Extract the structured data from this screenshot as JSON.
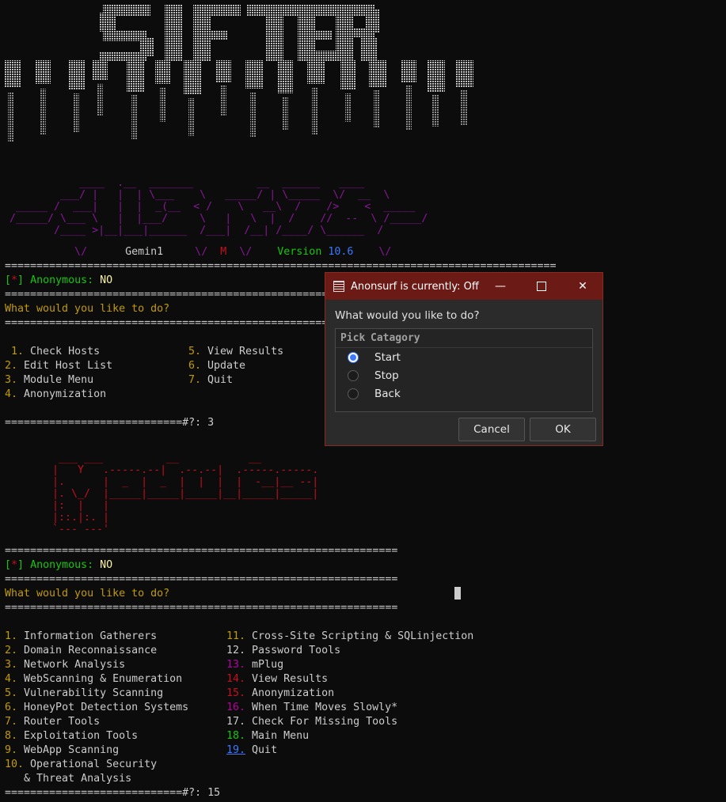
{
  "logo": {
    "text": "SIFTER",
    "subtitle_name": "Gemin1",
    "subtitle_m": "M",
    "version_label": "Version",
    "version_number": "10.6"
  },
  "separator_long": "=======================================================================================",
  "separator_med": "==============================================================",
  "status": {
    "bracket_open": "[",
    "star": "*",
    "bracket_close": "]",
    "label": "Anonymous:",
    "value": "NO"
  },
  "prompt_text": "What would you like to do?",
  "main_menu": {
    "left": [
      "1. Check Hosts",
      "2. Edit Host List",
      "3. Module Menu",
      "4. Anonymization"
    ],
    "right": [
      "5. View Results",
      "6. Update",
      "7. Quit"
    ],
    "input_prompt": "============================#?: 3"
  },
  "module_menu": {
    "left": [
      {
        "num": "1.",
        "label": "Information Gatherers"
      },
      {
        "num": "2.",
        "label": "Domain Reconnaissance"
      },
      {
        "num": "3.",
        "label": "Network Analysis"
      },
      {
        "num": "4.",
        "label": "WebScanning & Enumeration"
      },
      {
        "num": "5.",
        "label": "Vulnerability Scanning"
      },
      {
        "num": "6.",
        "label": "HoneyPot Detection Systems"
      },
      {
        "num": "7.",
        "label": "Router Tools"
      },
      {
        "num": "8.",
        "label": "Exploitation Tools"
      },
      {
        "num": "9.",
        "label": "WebApp Scanning"
      },
      {
        "num": "10.",
        "label": "Operational Security"
      }
    ],
    "left_continuation": "   & Threat Analysis",
    "right": [
      {
        "num": "11.",
        "label": "Cross-Site Scripting & SQLinjection"
      },
      {
        "num": "12.",
        "label": "Password Tools"
      },
      {
        "num": "13.",
        "label": "mPlug"
      },
      {
        "num": "14.",
        "label": "View Results"
      },
      {
        "num": "15.",
        "label": "Anonymization"
      },
      {
        "num": "16.",
        "label": "When Time Moves Slowly*"
      },
      {
        "num": "17.",
        "label": "Check For Missing Tools"
      },
      {
        "num": "18.",
        "label": "Main Menu"
      },
      {
        "num": "19.",
        "label": "Quit"
      }
    ],
    "input_prompt": "============================#?: 15"
  },
  "dialog": {
    "title": "Anonsurf is currently: Off",
    "prompt": "What would you like to do?",
    "columns": [
      "Pick",
      "Catagory"
    ],
    "options": [
      {
        "label": "Start",
        "selected": true
      },
      {
        "label": "Stop",
        "selected": false
      },
      {
        "label": "Back",
        "selected": false
      }
    ],
    "cancel_label": "Cancel",
    "ok_label": "OK",
    "min_glyph": "—",
    "close_glyph": "✕"
  },
  "colors": {
    "terminal_bg": "#0c0c0c",
    "dialog_titlebar": "#6b1a15",
    "accent_blue": "#3b78ff"
  }
}
